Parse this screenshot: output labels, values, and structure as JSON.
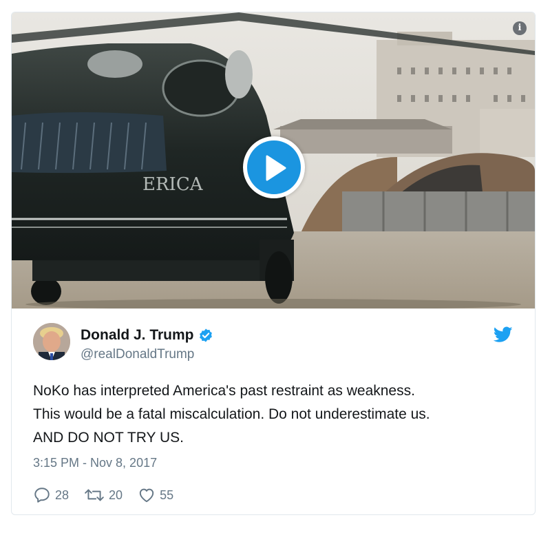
{
  "media": {
    "helicopter_lettering": "ERICA",
    "play_icon": "play-icon",
    "info_icon": "info-icon",
    "info_glyph": "i"
  },
  "tweet": {
    "author_name": "Donald J. Trump",
    "handle": "@realDonaldTrump",
    "verified_icon": "verified-badge-icon",
    "brand_icon": "twitter-bird-icon",
    "brand_color": "#1da1f2",
    "text": "NoKo has interpreted America's past restraint as weakness.\nThis would be a fatal miscalculation. Do not underestimate us.\nAND DO NOT TRY US.",
    "timestamp": "3:15 PM - Nov 8, 2017"
  },
  "actions": {
    "reply_count": "28",
    "retweet_count": "20",
    "like_count": "55"
  }
}
